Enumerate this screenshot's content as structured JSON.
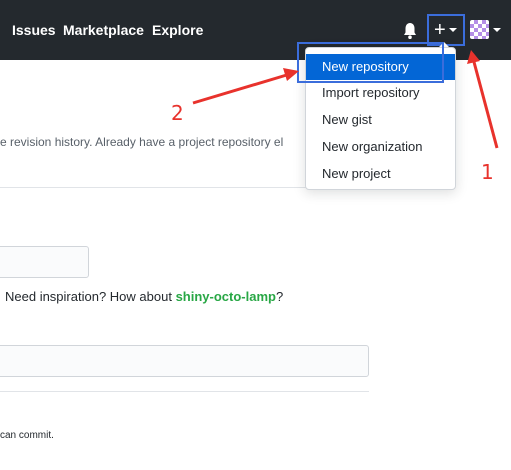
{
  "header": {
    "nav": [
      "Issues",
      "Marketplace",
      "Explore"
    ],
    "plus_label": "+",
    "icons": {
      "bell": "bell-icon",
      "plus": "plus-icon",
      "avatar": "avatar-icon"
    },
    "colors": {
      "background": "#24292e",
      "text": "#ffffff"
    }
  },
  "page": {
    "description_fragment": "e revision history. Already have a project repository el",
    "inspiration_prefix": "Need inspiration? How about ",
    "inspiration_suggestion": "shiny-octo-lamp",
    "inspiration_suffix": "?",
    "commit_note": "can commit."
  },
  "dropdown": {
    "items": [
      "New repository",
      "Import repository",
      "New gist",
      "New organization",
      "New project"
    ],
    "active_index": 0,
    "active_color": "#0366d6"
  },
  "annotations": {
    "label_1": "1",
    "label_2": "2",
    "color": "#e8322c",
    "highlight_color": "#3b6ddb"
  }
}
